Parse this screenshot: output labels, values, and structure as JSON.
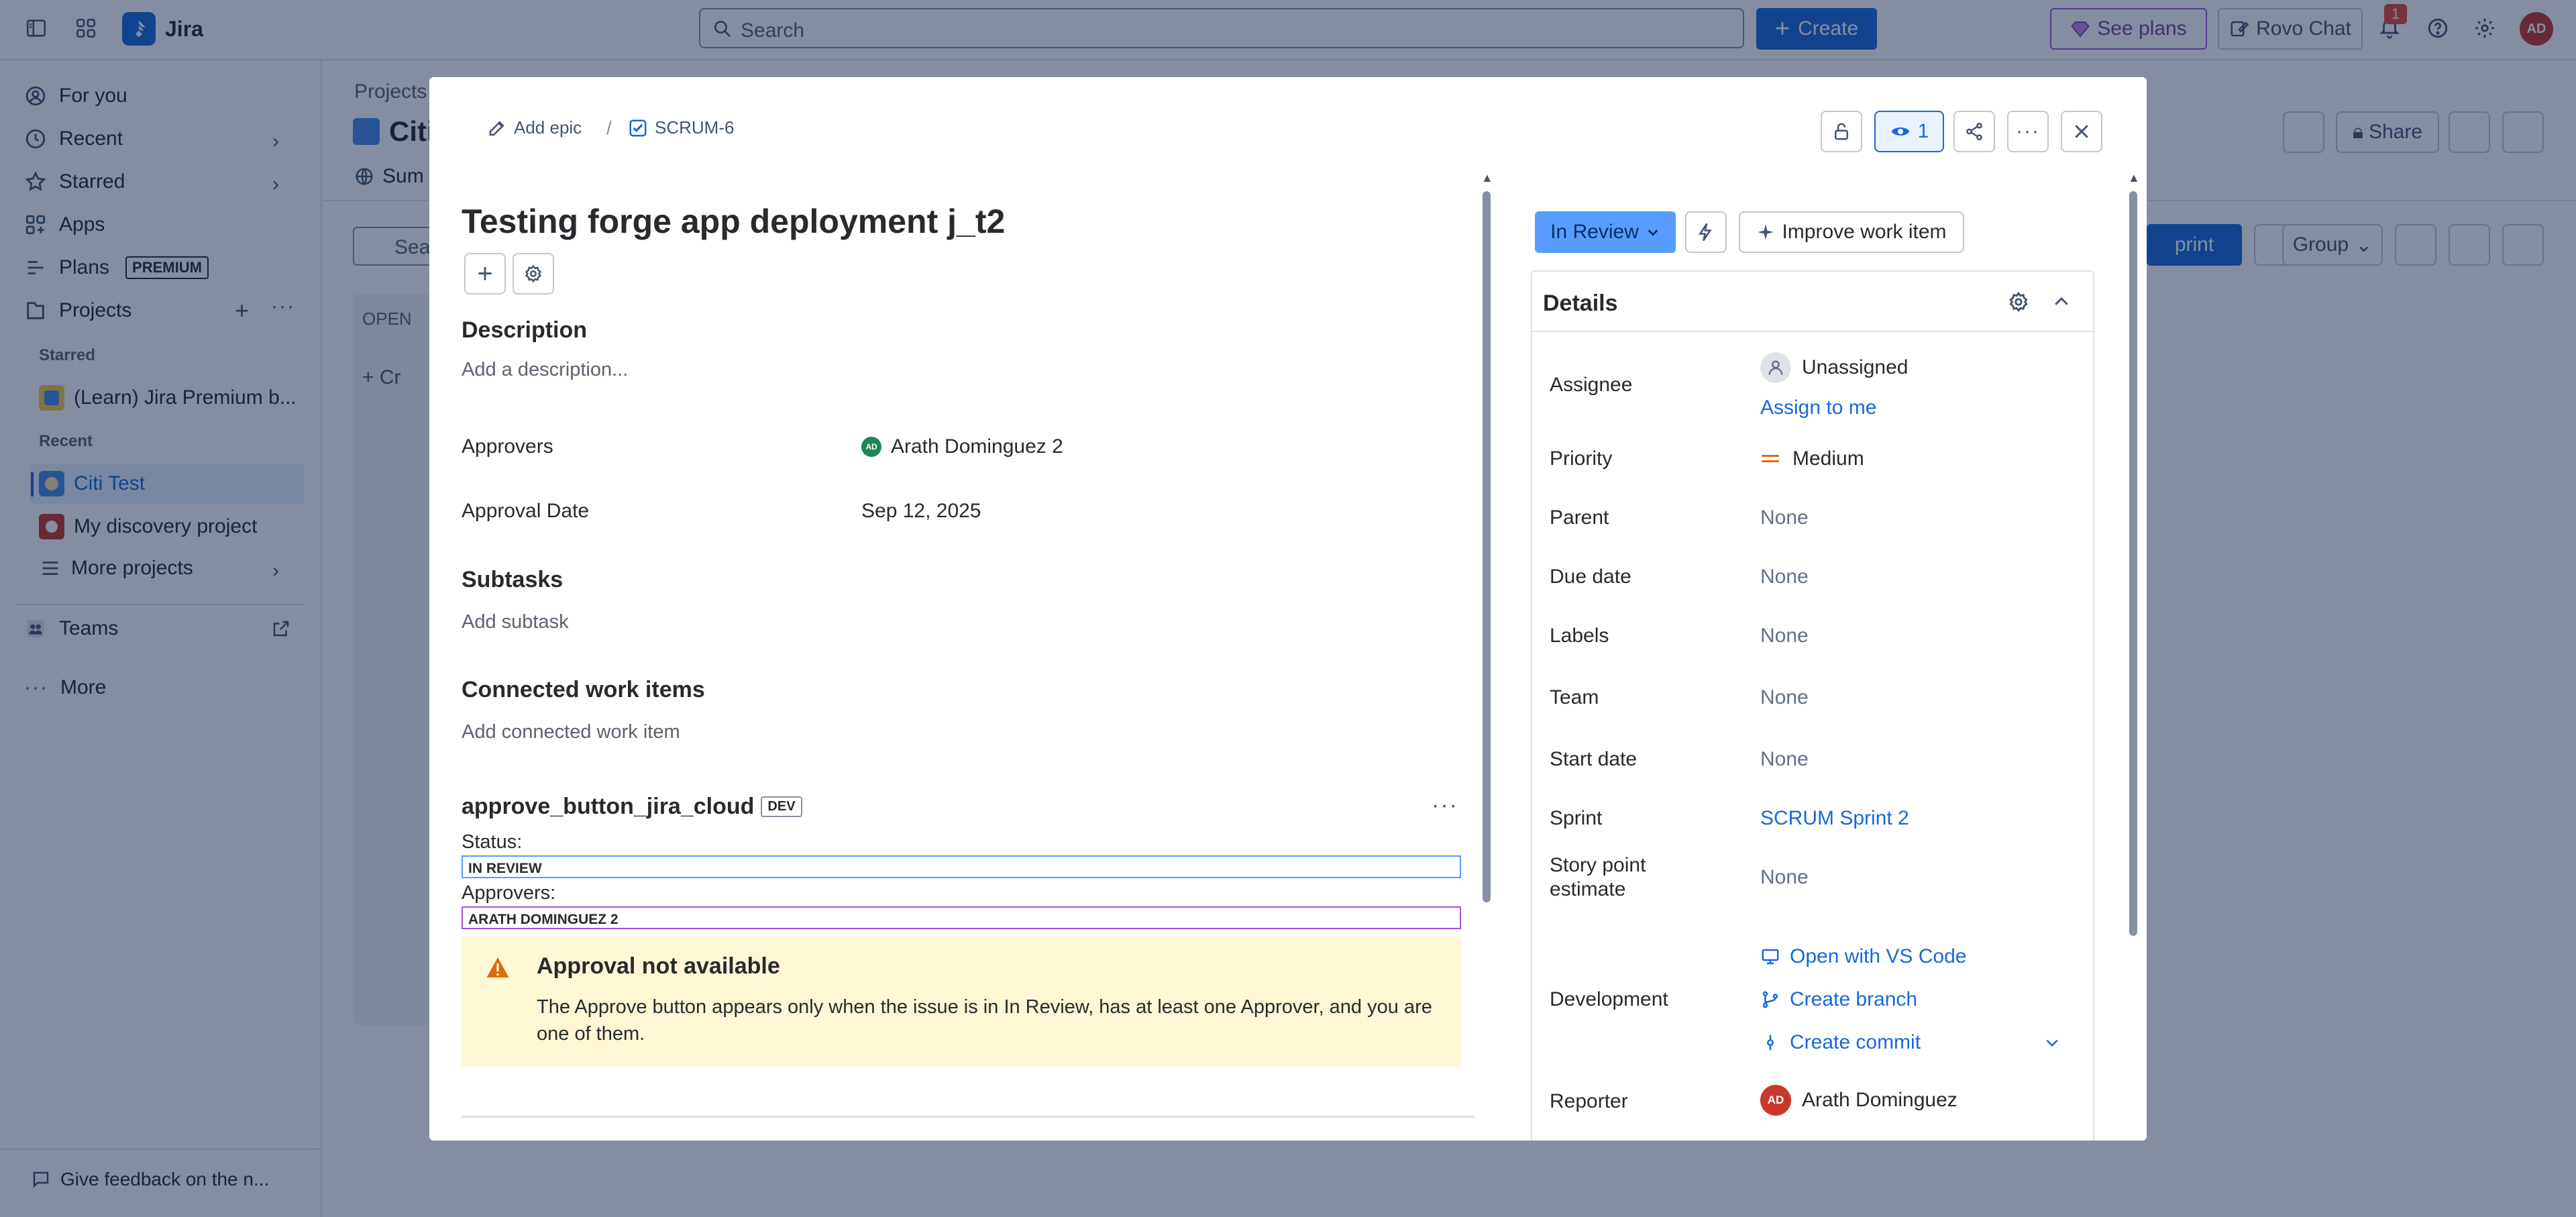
{
  "topbar": {
    "app_name": "Jira",
    "search_placeholder": "Search",
    "create_label": "Create",
    "see_plans_label": "See plans",
    "rovo_chat_label": "Rovo Chat",
    "notification_count": "1",
    "avatar_initials": "AD"
  },
  "sidebar": {
    "for_you": "For you",
    "recent": "Recent",
    "starred": "Starred",
    "apps": "Apps",
    "plans": "Plans",
    "premium_badge": "PREMIUM",
    "projects": "Projects",
    "starred_caption": "Starred",
    "starred_project": "(Learn) Jira Premium b...",
    "recent_caption": "Recent",
    "recent_project_1": "Citi Test",
    "recent_project_2": "My discovery project",
    "more_projects": "More projects",
    "teams": "Teams",
    "more": "More",
    "feedback": "Give feedback on the n..."
  },
  "background": {
    "breadcrumb": "Projects",
    "project_title": "Citi",
    "tab_summary": "Sum",
    "search_stub": "Sea",
    "column_open": "OPEN",
    "create_stub": "Cr",
    "share_label": "Share",
    "sprint_stub": "print",
    "group_label": "Group"
  },
  "modal": {
    "add_epic": "Add epic",
    "issue_key": "SCRUM-6",
    "watch_count": "1",
    "title": "Testing forge app deployment j_t2",
    "description_title": "Description",
    "description_placeholder": "Add a description...",
    "approvers_label": "Approvers",
    "approver_name": "Arath Dominguez 2",
    "approver_initials": "AD",
    "approval_date_label": "Approval Date",
    "approval_date_value": "Sep 12, 2025",
    "subtasks_title": "Subtasks",
    "add_subtask": "Add subtask",
    "connected_title": "Connected work items",
    "add_connected": "Add connected work item",
    "app_name": "approve_button_jira_cloud",
    "dev_badge": "DEV",
    "status_label": "Status:",
    "status_value": "IN REVIEW",
    "approvers_field_label": "Approvers:",
    "approvers_field_value": "ARATH DOMINGUEZ 2",
    "warning_title": "Approval not available",
    "warning_text": "The Approve button appears only when the issue is in In Review, has at least one Approver, and you are one of them.",
    "status_button": "In Review",
    "improve_label": "Improve work item",
    "details": {
      "heading": "Details",
      "assignee_label": "Assignee",
      "assignee_value": "Unassigned",
      "assign_to_me": "Assign to me",
      "priority_label": "Priority",
      "priority_value": "Medium",
      "parent_label": "Parent",
      "parent_value": "None",
      "due_date_label": "Due date",
      "due_date_value": "None",
      "labels_label": "Labels",
      "labels_value": "None",
      "team_label": "Team",
      "team_value": "None",
      "start_date_label": "Start date",
      "start_date_value": "None",
      "sprint_label": "Sprint",
      "sprint_value": "SCRUM Sprint 2",
      "story_points_label_1": "Story point",
      "story_points_label_2": "estimate",
      "story_points_value": "None",
      "development_label": "Development",
      "open_vscode": "Open with VS Code",
      "create_branch": "Create branch",
      "create_commit": "Create commit",
      "reporter_label": "Reporter",
      "reporter_value": "Arath Dominguez",
      "reporter_initials": "AD"
    }
  },
  "colors": {
    "brand_blue": "#1868db",
    "status_blue": "#579dff",
    "warning_bg": "#fff7d6",
    "warning_icon": "#e06c00",
    "priority_orange": "#e56910",
    "notification_red": "#e34935",
    "plans_purple": "#a056d8"
  }
}
